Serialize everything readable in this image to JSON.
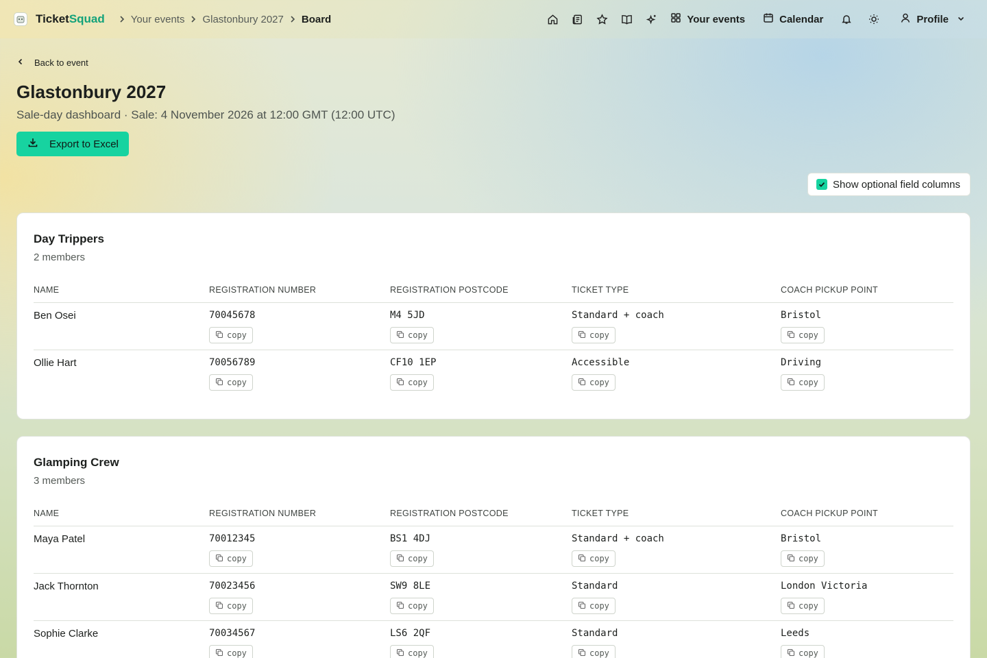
{
  "header": {
    "brand_prefix": "Ticket",
    "brand_suffix": "Squad",
    "breadcrumbs": [
      "Your events",
      "Glastonbury 2027",
      "Board"
    ],
    "nav": {
      "your_events": "Your events",
      "calendar": "Calendar",
      "profile": "Profile"
    }
  },
  "page": {
    "back_label": "Back to event",
    "title": "Glastonbury 2027",
    "subtitle": "Sale-day dashboard · Sale: 4 November 2026 at 12:00 GMT (12:00 UTC)",
    "export_label": "Export to Excel",
    "optional_toggle_label": "Show optional field columns",
    "optional_toggle_checked": true
  },
  "columns": [
    "NAME",
    "REGISTRATION NUMBER",
    "REGISTRATION POSTCODE",
    "TICKET TYPE",
    "COACH PICKUP POINT"
  ],
  "copy_label": "copy",
  "groups": [
    {
      "name": "Day Trippers",
      "count_label": "2 members",
      "members": [
        {
          "name": "Ben Osei",
          "reg_number": "70045678",
          "postcode": "M4 5JD",
          "ticket_type": "Standard + coach",
          "pickup": "Bristol"
        },
        {
          "name": "Ollie Hart",
          "reg_number": "70056789",
          "postcode": "CF10 1EP",
          "ticket_type": "Accessible",
          "pickup": "Driving"
        }
      ]
    },
    {
      "name": "Glamping Crew",
      "count_label": "3 members",
      "members": [
        {
          "name": "Maya Patel",
          "reg_number": "70012345",
          "postcode": "BS1 4DJ",
          "ticket_type": "Standard + coach",
          "pickup": "Bristol"
        },
        {
          "name": "Jack Thornton",
          "reg_number": "70023456",
          "postcode": "SW9 8LE",
          "ticket_type": "Standard",
          "pickup": "London Victoria"
        },
        {
          "name": "Sophie Clarke",
          "reg_number": "70034567",
          "postcode": "LS6 2QF",
          "ticket_type": "Standard",
          "pickup": "Leeds"
        }
      ]
    }
  ],
  "colors": {
    "accent": "#17d3a0",
    "brand_accent": "#13a27a"
  },
  "icons": [
    "logo-icon",
    "home-icon",
    "news-icon",
    "star-icon",
    "book-icon",
    "sparkle-icon",
    "grid-icon",
    "calendar-icon",
    "bell-icon",
    "sun-icon",
    "user-icon",
    "chevron-down-icon",
    "chevron-left-icon",
    "download-icon",
    "check-icon",
    "copy-icon"
  ]
}
